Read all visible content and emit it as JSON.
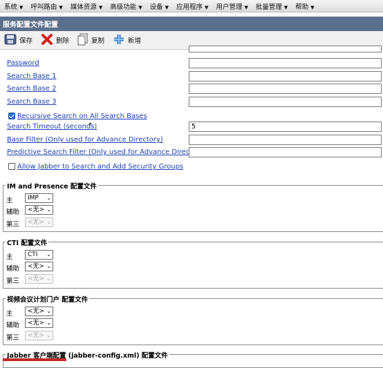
{
  "menu": [
    {
      "label": "系统"
    },
    {
      "label": "呼叫路由"
    },
    {
      "label": "媒体资源"
    },
    {
      "label": "高级功能"
    },
    {
      "label": "设备"
    },
    {
      "label": "应用程序"
    },
    {
      "label": "用户管理"
    },
    {
      "label": "批量管理"
    },
    {
      "label": "帮助"
    }
  ],
  "title": "服务配置文件配置",
  "toolbar": {
    "save": "保存",
    "delete": "删除",
    "copy": "复制",
    "add": "新增"
  },
  "fields": {
    "password": {
      "label": "Password",
      "value": ""
    },
    "search_base_1": {
      "label": "Search Base 1",
      "value": ""
    },
    "search_base_2": {
      "label": "Search Base 2",
      "value": ""
    },
    "search_base_3": {
      "label": "Search Base 3",
      "value": ""
    },
    "recursive": {
      "label": "Recursive Search on All Search Bases",
      "checked": true
    },
    "search_timeout": {
      "label": "Search Timeout (seconds)",
      "required": "*",
      "value": "5"
    },
    "base_filter": {
      "label": "Base Filter (Only used for Advance Directory)",
      "value": ""
    },
    "predictive_filter": {
      "label": "Predictive Search Filter (Only used for Advance Directory)",
      "value": ""
    },
    "allow_jabber": {
      "label": "Allow Jabber to Search and Add Security Groups",
      "checked": false
    }
  },
  "sections": {
    "im": {
      "legend": "IM and Presence 配置文件",
      "primary": {
        "label": "主",
        "value": "IMP"
      },
      "secondary": {
        "label": "辅助",
        "value": "<无>"
      },
      "tertiary": {
        "label": "第三",
        "value": "<无>"
      }
    },
    "cti": {
      "legend": "CTI 配置文件",
      "primary": {
        "label": "主",
        "value": "CTI"
      },
      "secondary": {
        "label": "辅助",
        "value": "<无>"
      },
      "tertiary": {
        "label": "第三",
        "value": "<无>"
      }
    },
    "video": {
      "legend": "视频会议计划门户 配置文件",
      "primary": {
        "label": "主",
        "value": "<无>"
      },
      "secondary": {
        "label": "辅助",
        "value": "<无>"
      },
      "tertiary": {
        "label": "第三",
        "value": "<无>"
      }
    },
    "jabber": {
      "legend": "Jabber 客户端配置 (jabber-config.xml) 配置文件"
    }
  },
  "colors": {
    "title_bg": "#5b6e8c",
    "link": "#1a3fb0",
    "checkbox": "#2f6fd6"
  }
}
